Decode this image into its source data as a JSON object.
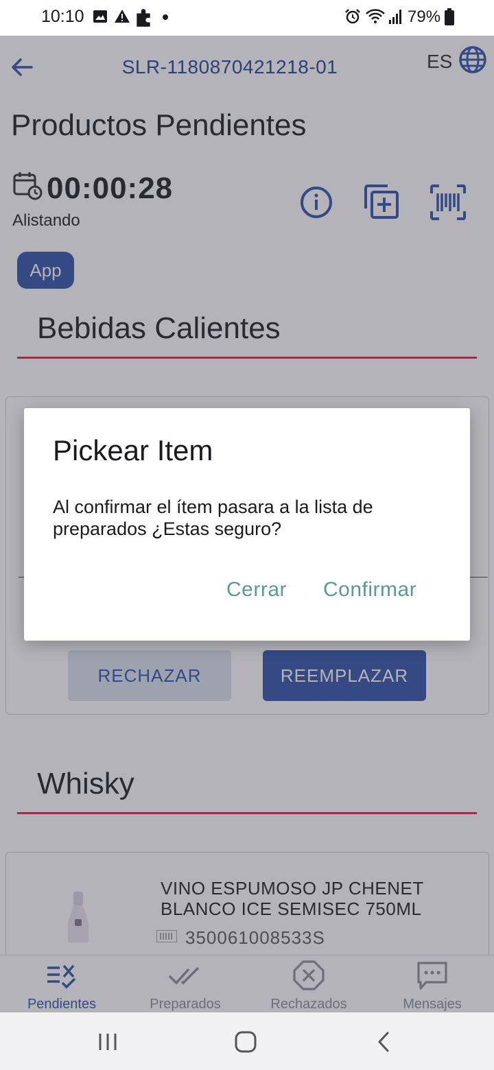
{
  "status_bar": {
    "time": "10:10",
    "battery": "79%"
  },
  "header": {
    "order_id": "SLR-1180870421218-01",
    "language": "ES"
  },
  "page": {
    "title": "Productos Pendientes",
    "timer": "00:00:28",
    "status": "Alistando",
    "chip": "App"
  },
  "sections": [
    {
      "title": "Bebidas Calientes"
    },
    {
      "title": "Whisky"
    }
  ],
  "card_actions": {
    "reject": "RECHAZAR",
    "replace": "REEMPLAZAR"
  },
  "product": {
    "name": "VINO ESPUMOSO JP CHENET BLANCO ICE SEMISEC 750ML",
    "code": "350061008533S"
  },
  "bottom_nav": [
    {
      "label": "Pendientes",
      "icon": "list-check-icon",
      "active": true
    },
    {
      "label": "Preparados",
      "icon": "double-check-icon",
      "active": false
    },
    {
      "label": "Rechazados",
      "icon": "x-octagon-icon",
      "active": false
    },
    {
      "label": "Mensajes",
      "icon": "message-icon",
      "active": false
    }
  ],
  "dialog": {
    "title": "Pickear Item",
    "message": "Al confirmar el ítem pasara a la lista de preparados ¿Estas seguro?",
    "cancel": "Cerrar",
    "confirm": "Confirmar"
  },
  "colors": {
    "primary": "#2e4fa8",
    "accent_rule": "#c8284f",
    "dialog_action": "#5b9b8f"
  }
}
